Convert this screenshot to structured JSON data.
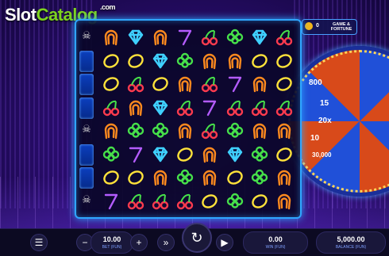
{
  "brand": {
    "prefix": "Slot",
    "accent": "Catalog",
    "suffix": ".com"
  },
  "bonus_badge": {
    "count": "0",
    "line1": "GAME &",
    "line2": "FORTUNE"
  },
  "wheel": {
    "labels": [
      "800",
      "15",
      "20x",
      "10",
      "30,000"
    ]
  },
  "grid": {
    "rows": [
      [
        "horseshoe",
        "diamond",
        "horseshoe",
        "seven",
        "cherry",
        "clover",
        "diamond",
        "cherry"
      ],
      [
        "lemon",
        "lemon",
        "diamond",
        "clover",
        "horseshoe",
        "horseshoe",
        "lemon",
        "lemon"
      ],
      [
        "lemon",
        "cherry",
        "lemon",
        "horseshoe",
        "cherry",
        "seven",
        "horseshoe",
        "lemon"
      ],
      [
        "cherry",
        "horseshoe",
        "diamond",
        "cherry",
        "seven",
        "cherry",
        "cherry",
        "cherry"
      ],
      [
        "horseshoe",
        "clover",
        "clover",
        "horseshoe",
        "cherry",
        "clover",
        "horseshoe",
        "horseshoe"
      ],
      [
        "clover",
        "seven",
        "diamond",
        "lemon",
        "horseshoe",
        "diamond",
        "clover",
        "lemon"
      ],
      [
        "lemon",
        "lemon",
        "horseshoe",
        "clover",
        "horseshoe",
        "lemon",
        "clover",
        "horseshoe"
      ],
      [
        "seven",
        "cherry",
        "cherry",
        "cherry",
        "lemon",
        "clover",
        "lemon",
        "horseshoe"
      ]
    ]
  },
  "meter": {
    "skull_rows": [
      0,
      4,
      7
    ]
  },
  "controls": {
    "bet_value": "10.00",
    "bet_label": "BET (FUN)",
    "win_value": "0.00",
    "win_label": "WIN (FUN)",
    "balance_value": "5,000.00",
    "balance_label": "BALANCE (FUN)"
  },
  "colors": {
    "horseshoe": "#ff8a1e",
    "diamond": "#3fd0ff",
    "seven": "#b45cff",
    "cherry": "#ff3b4e",
    "clover": "#46e04a",
    "lemon": "#ffe23a"
  }
}
